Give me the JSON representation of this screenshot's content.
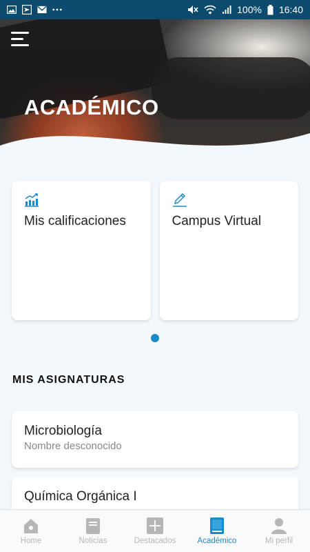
{
  "status_bar": {
    "left_icons": [
      "image-icon",
      "send-icon",
      "mail-icon",
      "more-icon"
    ],
    "right_icons": [
      "mute-icon",
      "wifi-icon",
      "signal-icon",
      "battery-icon"
    ],
    "battery": "100%",
    "time": "16:40"
  },
  "header": {
    "title": "ACADÉMICO",
    "menu_icon": "menu-icon"
  },
  "shortcuts": [
    {
      "label": "Mis calificaciones",
      "icon": "chart-icon"
    },
    {
      "label": "Campus Virtual",
      "icon": "edit-icon"
    }
  ],
  "carousel": {
    "page": 1,
    "pages": 1
  },
  "subjects_section": {
    "title": "MIS ASIGNATURAS",
    "items": [
      {
        "name": "Microbiología",
        "teacher": "Nombre desconocido"
      },
      {
        "name": "Química Orgánica I",
        "teacher": ""
      }
    ]
  },
  "bottom_nav": {
    "items": [
      {
        "label": "Home",
        "icon": "home-icon",
        "active": false
      },
      {
        "label": "Noticias",
        "icon": "news-icon",
        "active": false
      },
      {
        "label": "Destacados",
        "icon": "plus-icon",
        "active": false
      },
      {
        "label": "Académico",
        "icon": "book-icon",
        "active": true
      },
      {
        "label": "Mi perfil",
        "icon": "profile-icon",
        "active": false
      }
    ]
  },
  "colors": {
    "accent": "#1b8ac9",
    "status_bar": "#0c4a6e",
    "background": "#f3f8fc",
    "inactive": "#b6b6b6"
  }
}
